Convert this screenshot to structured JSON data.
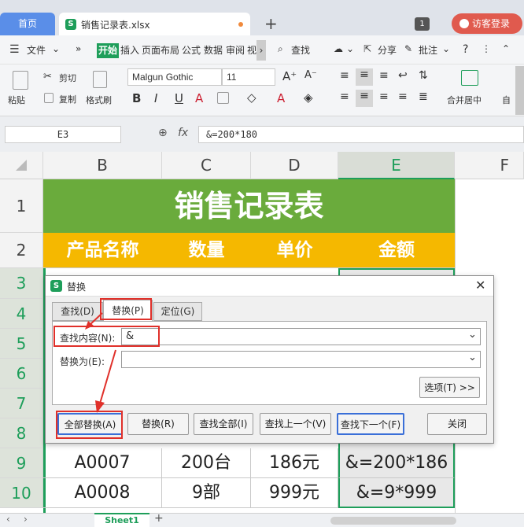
{
  "tabs": {
    "home": "首页",
    "file": "销售记录表.xlsx",
    "plus": "+",
    "badge": "1",
    "login": "访客登录"
  },
  "menu": {
    "file": "文件",
    "kaishi": "开始",
    "insert": "插入",
    "layout": "页面布局",
    "formula": "公式",
    "data": "数据",
    "review": "审阅",
    "more": "视",
    "search": "查找",
    "share": "分享",
    "annotate": "批注"
  },
  "toolbar": {
    "paste": "粘贴",
    "cut": "剪切",
    "copy": "复制",
    "format_painter": "格式刷",
    "font": "Malgun Gothic",
    "size": "11",
    "merge": "合并居中",
    "auto": "自"
  },
  "formula": {
    "namebox": "E3",
    "fx": "fx",
    "value": "&=200*180"
  },
  "columns": [
    "B",
    "C",
    "D",
    "E",
    "F"
  ],
  "rows": [
    "1",
    "2",
    "3",
    "4",
    "5",
    "6",
    "7",
    "8",
    "9",
    "10"
  ],
  "sheet": {
    "title": "销售记录表",
    "headers": [
      "产品名称",
      "数量",
      "单价",
      "金额"
    ],
    "row9": [
      "A0007",
      "200台",
      "186元",
      "&=200*186"
    ],
    "row10": [
      "A0008",
      "9部",
      "999元",
      "&=9*999"
    ]
  },
  "dialog": {
    "title": "替换",
    "tabs": [
      "查找(D)",
      "替换(P)",
      "定位(G)"
    ],
    "find_label": "查找内容(N):",
    "find_value": "&",
    "replace_label": "替换为(E):",
    "replace_value": "",
    "options": "选项(T) >>",
    "buttons": [
      "全部替换(A)",
      "替换(R)",
      "查找全部(I)",
      "查找上一个(V)",
      "查找下一个(F)",
      "关闭"
    ]
  },
  "sheetbar": {
    "tab": "Sheet1",
    "add": "+"
  },
  "colors": {
    "green": "#6aab3c",
    "yellow": "#f5b800",
    "red": "#e0302a",
    "accent": "#1e9e5a"
  }
}
